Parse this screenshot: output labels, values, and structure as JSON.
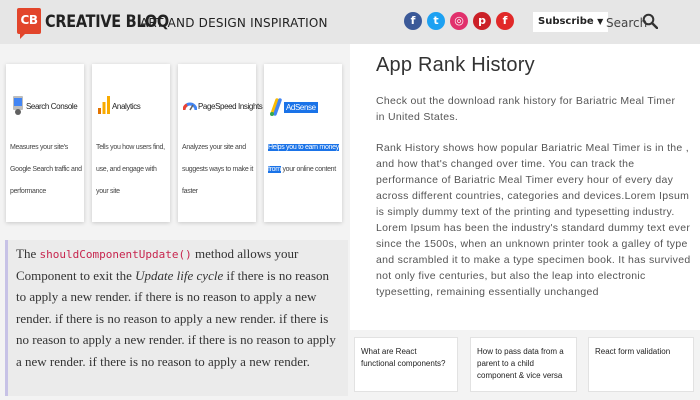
{
  "header": {
    "logo_text": "CB",
    "brand": "CREATIVE BLOQ",
    "tagline": "ART AND DESIGN INSPIRATION",
    "social": [
      {
        "icon": "facebook-icon",
        "glyph": "f",
        "color": "#3b5998"
      },
      {
        "icon": "twitter-icon",
        "glyph": "t",
        "color": "#1da1f2"
      },
      {
        "icon": "instagram-icon",
        "glyph": "◎",
        "color": "#e1306c"
      },
      {
        "icon": "pinterest-icon",
        "glyph": "p",
        "color": "#cb2027"
      },
      {
        "icon": "flipboard-icon",
        "glyph": "f",
        "color": "#e12828"
      }
    ],
    "subscribe": "Subscribe",
    "subscribe_caret": "▼",
    "search": "Search"
  },
  "cards": [
    {
      "title": "Search Console",
      "desc": "Measures your site's Google Search traffic and performance",
      "icon": "search-console-icon"
    },
    {
      "title": "Analytics",
      "desc": "Tells you how users find, use, and engage with your site",
      "icon": "analytics-icon"
    },
    {
      "title": "PageSpeed Insights",
      "desc": "Analyzes your site and suggests ways to make it faster",
      "icon": "pagespeed-icon"
    },
    {
      "title": "AdSense",
      "desc_highlight": "Helps you to earn money from",
      "desc_rest": "your online content",
      "icon": "adsense-icon"
    }
  ],
  "article": {
    "part1": "The ",
    "code": "shouldComponentUpdate()",
    "part2": " method allows your Component to exit the ",
    "emphasis": "Update life cycle",
    "part3": " if there is no reason to apply a new render. if there is no reason to apply a new render. if there is no reason to apply a new render. if there is no reason to apply a new render. if there is no reason to apply a new render. if there is no reason to apply a new render."
  },
  "rank": {
    "title": "App Rank History",
    "intro": "Check out the download rank history for Bariatric Meal Timer in United States.",
    "body": "Rank History shows how popular Bariatric Meal Timer is in the , and how that's changed over time. You can track the performance of Bariatric Meal Timer every hour of every day across different countries, categories and devices.Lorem Ipsum is simply dummy text of the printing and typesetting industry. Lorem Ipsum has been the industry's standard dummy text ever since the 1500s, when an unknown printer took a galley of type and scrambled it to make a type specimen book. It has survived not only five centuries, but also the leap into electronic typesetting, remaining essentially unchanged"
  },
  "related": [
    "What are React functional components?",
    "How to pass data from a parent to a child component & vice versa",
    "React form validation"
  ]
}
